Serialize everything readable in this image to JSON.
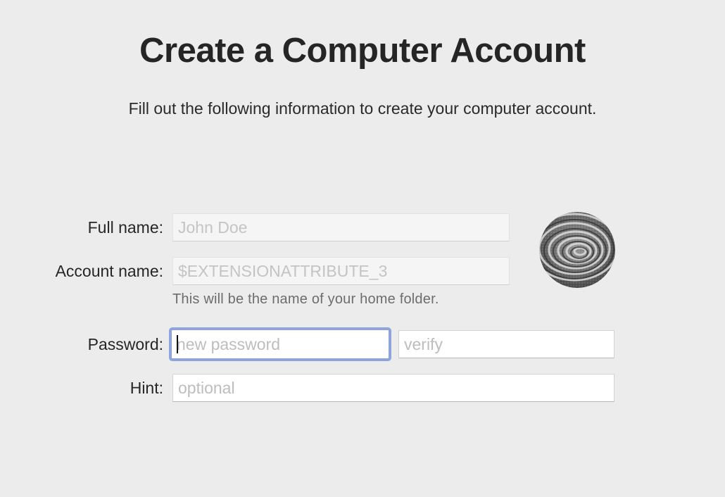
{
  "header": {
    "title": "Create a Computer Account",
    "subtitle": "Fill out the following information to create your computer account."
  },
  "form": {
    "full_name": {
      "label": "Full name:",
      "placeholder": "John Doe"
    },
    "account_name": {
      "label": "Account name:",
      "placeholder": "$EXTENSIONATTRIBUTE_3",
      "help": "This will be the name of your home folder."
    },
    "password": {
      "label": "Password:",
      "placeholder": "new password",
      "verify_placeholder": "verify"
    },
    "hint": {
      "label": "Hint:",
      "placeholder": "optional"
    }
  },
  "avatar": {
    "icon": "zen-sand-spiral-picture"
  },
  "colors": {
    "background": "#ececec",
    "focus_ring": "#8da4de",
    "placeholder": "#bdbdbd"
  }
}
